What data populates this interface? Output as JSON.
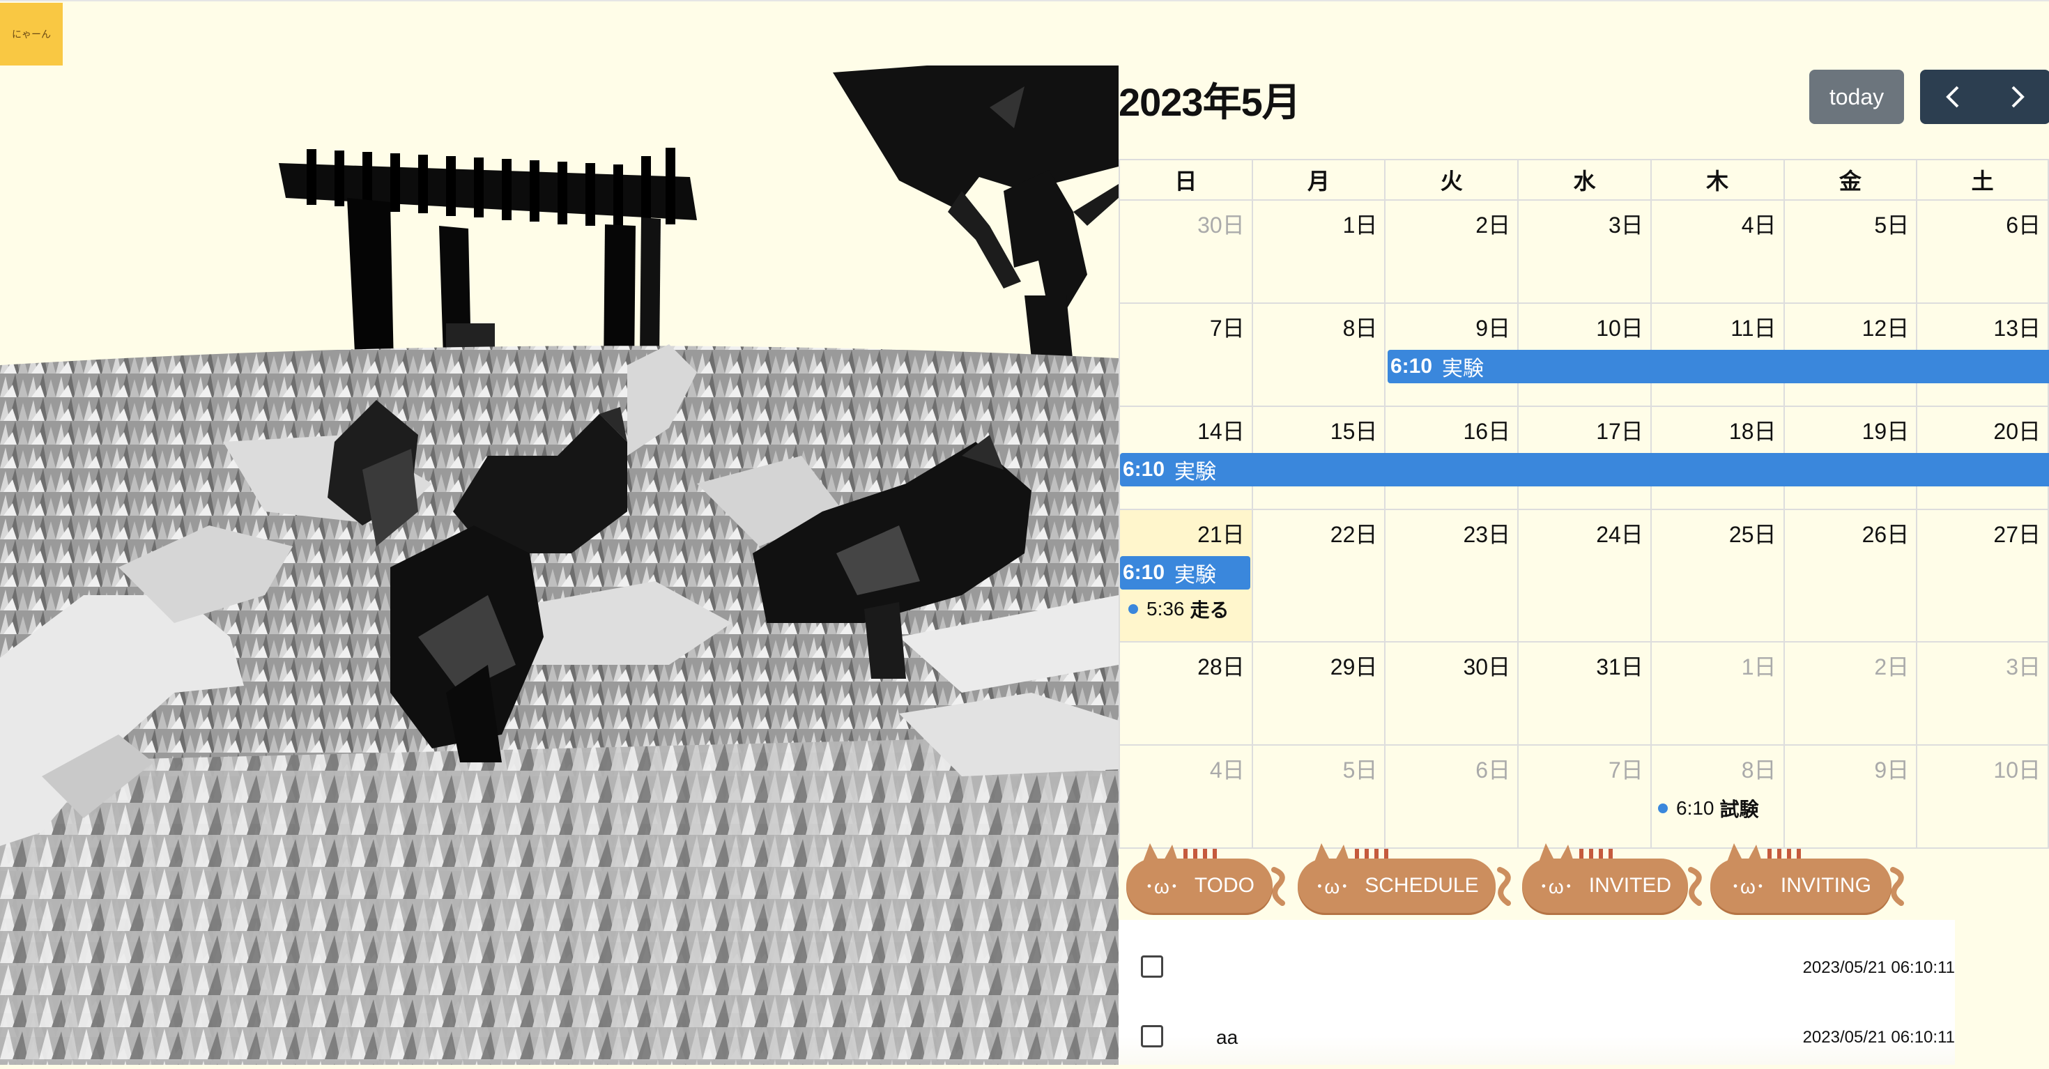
{
  "app": {
    "logo_label": "にゃーん"
  },
  "calendar": {
    "title": "2023年5月",
    "today_label": "today",
    "weekdays": [
      "日",
      "月",
      "火",
      "水",
      "木",
      "金",
      "土"
    ],
    "weeks": [
      [
        "30日",
        "1日",
        "2日",
        "3日",
        "4日",
        "5日",
        "6日"
      ],
      [
        "7日",
        "8日",
        "9日",
        "10日",
        "11日",
        "12日",
        "13日"
      ],
      [
        "14日",
        "15日",
        "16日",
        "17日",
        "18日",
        "19日",
        "20日"
      ],
      [
        "21日",
        "22日",
        "23日",
        "24日",
        "25日",
        "26日",
        "27日"
      ],
      [
        "28日",
        "29日",
        "30日",
        "31日",
        "1日",
        "2日",
        "3日"
      ],
      [
        "4日",
        "5日",
        "6日",
        "7日",
        "8日",
        "9日",
        "10日"
      ]
    ],
    "events": {
      "bar_w2": {
        "time": "6:10",
        "title": "実験"
      },
      "bar_w3": {
        "time": "6:10",
        "title": "実験"
      },
      "bar_w4": {
        "time": "6:10",
        "title": "実験"
      },
      "dot_w4": {
        "time": "5:36",
        "title": "走る"
      },
      "dot_w6": {
        "time": "6:10",
        "title": "試験"
      }
    },
    "event_color": "#3a87dc",
    "today_highlight": "#fff6cc"
  },
  "tabs": [
    {
      "face": "･ω･",
      "label": "TODO"
    },
    {
      "face": "･ω･",
      "label": "SCHEDULE"
    },
    {
      "face": "･ω･",
      "label": "INVITED"
    },
    {
      "face": "･ω･",
      "label": "INVITING"
    }
  ],
  "todos": [
    {
      "text": "",
      "date": "2023/05/21 06:10:11"
    },
    {
      "text": "aa",
      "date": "2023/05/21 06:10:11"
    }
  ]
}
